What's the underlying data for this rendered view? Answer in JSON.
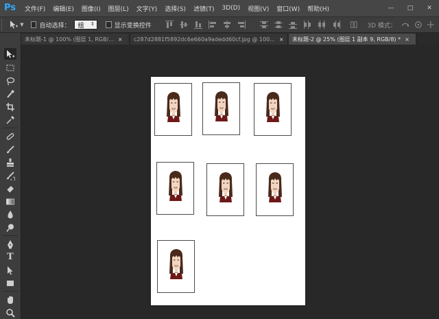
{
  "app": {
    "logo": "Ps"
  },
  "menu": [
    "文件(F)",
    "编辑(E)",
    "图像(I)",
    "图层(L)",
    "文字(Y)",
    "选择(S)",
    "滤镜(T)",
    "3D(D)",
    "视图(V)",
    "窗口(W)",
    "帮助(H)"
  ],
  "window_controls": {
    "minimize": "—",
    "maximize": "□",
    "close": "✕"
  },
  "options": {
    "auto_select_label": "自动选择：",
    "auto_select_value": "组",
    "auto_select_checked": false,
    "show_transform_label": "显示变换控件",
    "show_transform_checked": false,
    "mode_3d_label": "3D 模式："
  },
  "tabs": [
    {
      "label": "未标题-1 @ 100% (图层 1, RGB/...",
      "close": "×",
      "active": false
    },
    {
      "label": "c287d2881f5892dc6e660a9adedd60cf.jpg @ 100...",
      "close": "×",
      "active": false
    },
    {
      "label": "未标题-2 @ 25% (图层 1 副本 9, RGB/8) *",
      "close": "×",
      "active": true
    }
  ],
  "tools": [
    "move-tool-icon",
    "marquee-tool-icon",
    "lasso-tool-icon",
    "quick-select-tool-icon",
    "crop-tool-icon",
    "eyedropper-tool-icon",
    "healing-brush-tool-icon",
    "brush-tool-icon",
    "clone-stamp-tool-icon",
    "history-brush-tool-icon",
    "eraser-tool-icon",
    "gradient-tool-icon",
    "blur-tool-icon",
    "dodge-tool-icon",
    "pen-tool-icon",
    "type-tool-icon",
    "path-select-tool-icon",
    "rectangle-tool-icon",
    "hand-tool-icon",
    "zoom-tool-icon"
  ],
  "canvas": {
    "photo_count": 7,
    "photo_subject": "portrait-icon"
  },
  "colors": {
    "accent": "#31a8ff",
    "workspace": "#282828",
    "document": "#ffffff"
  }
}
